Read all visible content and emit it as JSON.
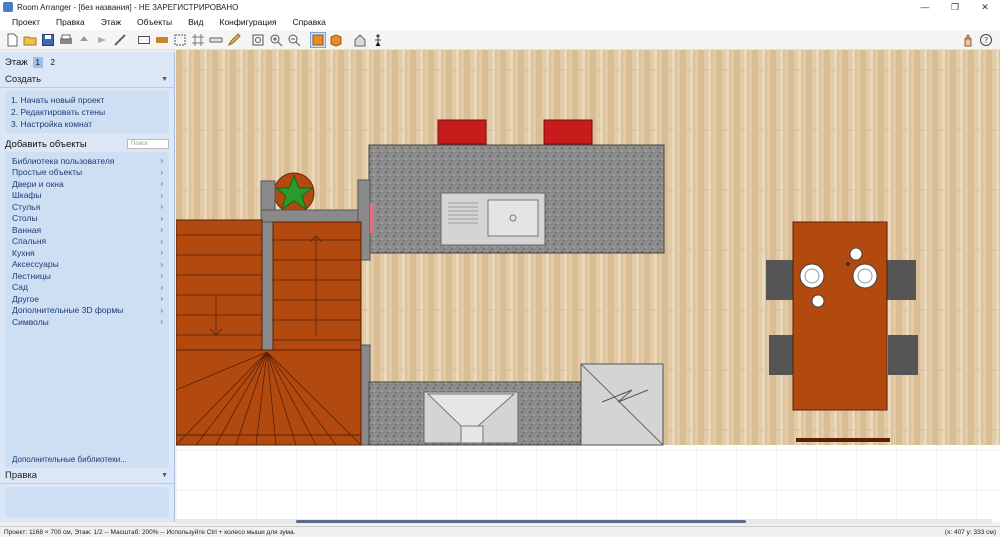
{
  "window": {
    "title": "Room Arranger - [без названия] - НЕ ЗАРЕГИСТРИРОВАНО",
    "minimize": "—",
    "maximize": "❐",
    "close": "✕"
  },
  "menu": [
    "Проект",
    "Правка",
    "Этаж",
    "Объекты",
    "Вид",
    "Конфигурация",
    "Справка"
  ],
  "sidebar": {
    "floor_label": "Этаж",
    "floors": [
      "1",
      "2"
    ],
    "create": {
      "header": "Создать",
      "steps": [
        "1. Начать новый проект",
        "2. Редактировать стены",
        "3. Настройка комнат"
      ]
    },
    "add_objects": {
      "header": "Добавить объекты",
      "search_placeholder": "Поиск",
      "items": [
        "Библиотека пользователя",
        "Простые объекты",
        "Двери и окна",
        "Шкафы",
        "Стулья",
        "Столы",
        "Ванная",
        "Спальня",
        "Кухня",
        "Аксессуары",
        "Лестницы",
        "Сад",
        "Другое",
        "Дополнительные 3D формы",
        "Символы"
      ],
      "more_libraries": "Дополнительные библиотеки..."
    },
    "edit": {
      "header": "Правка"
    }
  },
  "status": {
    "left": "Проект: 1168 × 700 см, Этаж: 1/2 -- Масштаб: 200% -- Используйте Ctrl + колесо мыши для зума.",
    "right": "(x: 407 y: 333 см)"
  },
  "toolbar_icons": [
    "new-icon",
    "open-icon",
    "save-icon",
    "print-icon",
    "undo-icon",
    "redo-icon",
    "wall-tool-icon",
    "measure-icon",
    "door-icon",
    "select-area-icon",
    "grid-icon",
    "ruler-icon",
    "pencil-icon",
    "zoom-fit-icon",
    "zoom-in-icon",
    "zoom-out-icon",
    "view-2d-icon",
    "view-3d-icon",
    "furniture-icon",
    "walk-icon"
  ],
  "colors": {
    "sidebar_bg": "#dbe7f6",
    "wood": "#e3cba8",
    "granite": "#8a8a8a",
    "brick": "#b24a10",
    "accent_active": "#9dc0ea"
  }
}
